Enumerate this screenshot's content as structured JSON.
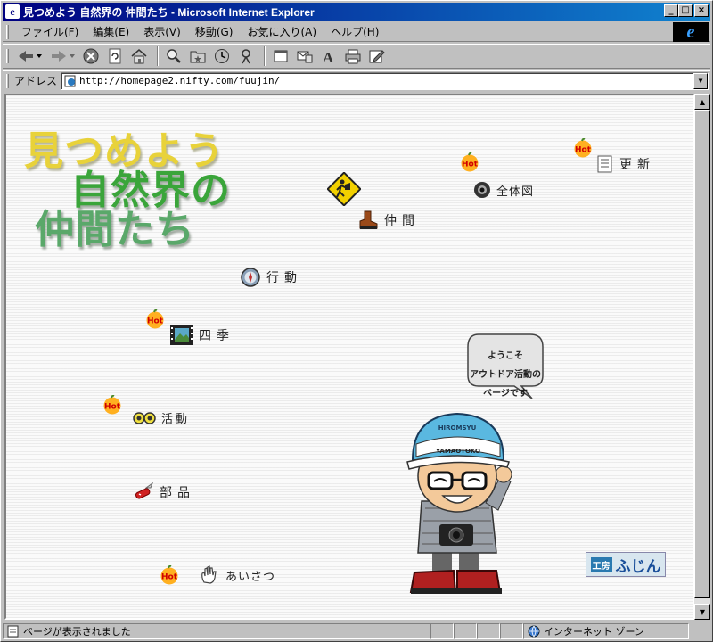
{
  "window": {
    "title": "見つめよう 自然界の 仲間たち - Microsoft Internet Explorer",
    "btn_minimize": "_",
    "btn_maximize": "□",
    "btn_close": "×"
  },
  "menu": {
    "items": [
      "ファイル(F)",
      "編集(E)",
      "表示(V)",
      "移動(G)",
      "お気に入り(A)",
      "ヘルプ(H)"
    ],
    "ie_logo": "e"
  },
  "address": {
    "label": "アドレス",
    "url": "http://homepage2.nifty.com/fuujin/"
  },
  "page": {
    "logo_line1": "見つめよう",
    "logo_line2": "自然界の",
    "logo_line3": "仲間たち",
    "hot": "Hot",
    "nav": {
      "koushin": "更新",
      "zentaizu": "全体図",
      "nakama": "仲間",
      "koudou": "行動",
      "shiki": "四季",
      "katsudou": "活動",
      "buhin": "部品",
      "aisatsu": "あいさつ"
    },
    "bubble": [
      "ようこそ",
      "アウトドア活動の",
      "ページです"
    ],
    "cap_text_top": "HIROMSYU",
    "cap_text_band": "YAMAOTOKO",
    "badge_a": "工房",
    "badge_b": "ふじん"
  },
  "status": {
    "text": "ページが表示されました",
    "zone": "インターネット ゾーン"
  },
  "colors": {
    "title_start": "#000080",
    "title_end": "#1084d0",
    "logo_yellow": "#e8d23a",
    "logo_green": "#3aa53a",
    "hot_orange": "#ffb020",
    "hot_text": "#d00000"
  }
}
